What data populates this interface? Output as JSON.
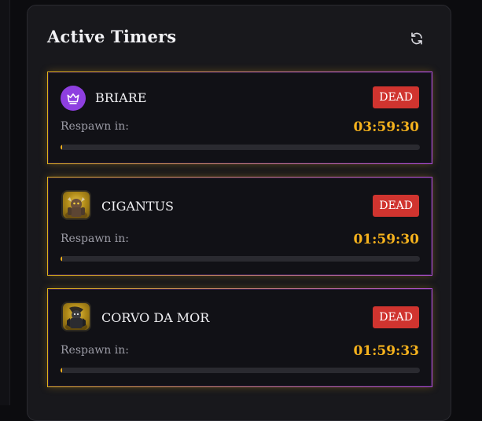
{
  "panel": {
    "title": "Active Timers",
    "refresh_icon": "refresh-icon"
  },
  "colors": {
    "accent_gold": "#f5b21d",
    "dead_red": "#d0342f",
    "crown_purple": "#8e3fe0"
  },
  "timers": [
    {
      "name": "BRIARE",
      "icon": "crown-icon",
      "status": "DEAD",
      "respawn_label": "Respawn in:",
      "time": "03:59:30",
      "progress": 0.004
    },
    {
      "name": "CIGANTUS",
      "icon": "boss-portrait",
      "status": "DEAD",
      "respawn_label": "Respawn in:",
      "time": "01:59:30",
      "progress": 0.004
    },
    {
      "name": "CORVO DA MOR",
      "icon": "boss-portrait",
      "status": "DEAD",
      "respawn_label": "Respawn in:",
      "time": "01:59:33",
      "progress": 0.004
    }
  ]
}
